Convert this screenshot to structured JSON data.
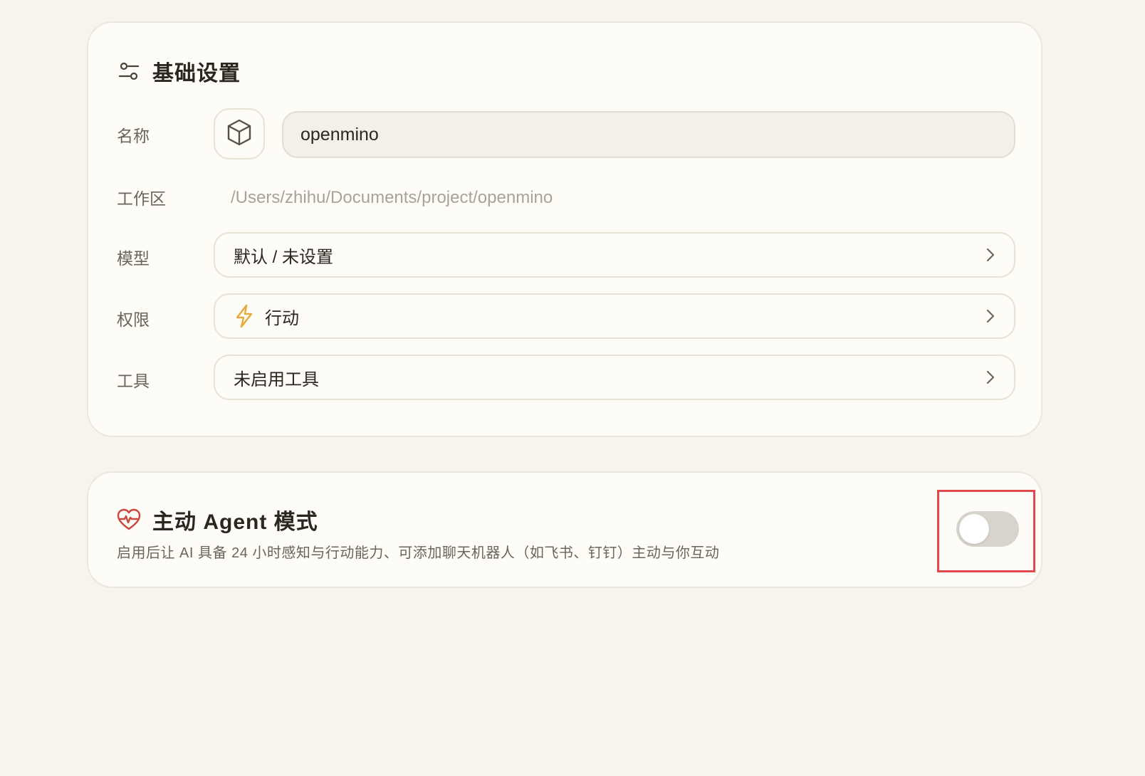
{
  "basic_settings": {
    "title": "基础设置",
    "icon": "sliders-icon",
    "name": {
      "label": "名称",
      "avatar_icon": "cube-icon",
      "value": "openmino"
    },
    "workspace": {
      "label": "工作区",
      "path": "/Users/zhihu/Documents/project/openmino"
    },
    "model": {
      "label": "模型",
      "value": "默认 / 未设置"
    },
    "permission": {
      "label": "权限",
      "icon": "lightning-icon",
      "value": "行动"
    },
    "tools": {
      "label": "工具",
      "value": "未启用工具"
    }
  },
  "agent_mode": {
    "title": "主动 Agent 模式",
    "icon": "heart-pulse-icon",
    "description": "启用后让 AI 具备 24 小时感知与行动能力、可添加聊天机器人（如飞书、钉钉）主动与你互动",
    "enabled": false
  },
  "colors": {
    "background": "#f7f4ee",
    "card": "#fefcf7",
    "accent_bolt": "#e8a83a",
    "heart": "#c9473f",
    "highlight_box": "#e2494c",
    "toggle_off": "#d8d4cd"
  }
}
